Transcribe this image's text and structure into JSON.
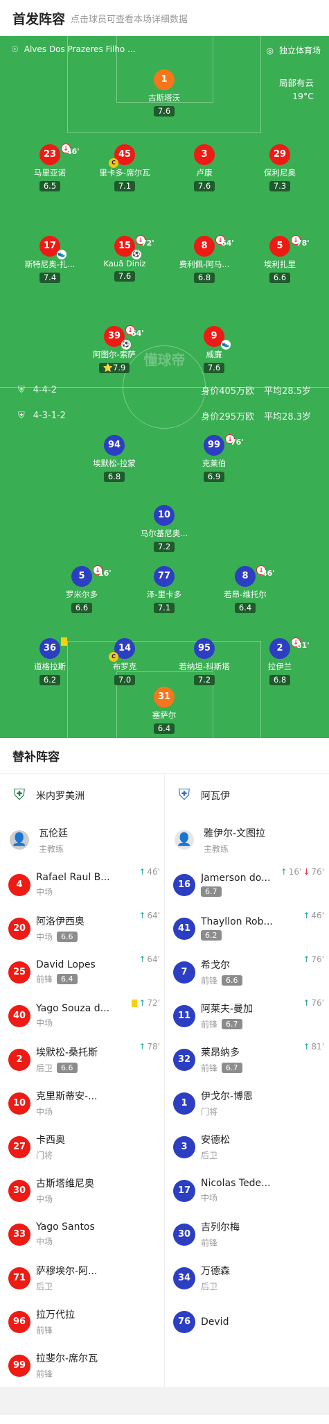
{
  "header": {
    "title": "首发阵容",
    "subtitle": "点击球员可查看本场详细数据"
  },
  "pitch_info": {
    "referee": "Alves Dos Prazeres Filho ...",
    "venue": "独立体育场",
    "weather": "局部有云",
    "temp": "19°C",
    "watermark": "懂球帝"
  },
  "home": {
    "formation": "4-4-2",
    "value": "身价405万欧",
    "age": "平均28.5岁",
    "color": "#ee1a14"
  },
  "away": {
    "formation": "4-3-1-2",
    "value": "身价295万欧",
    "age": "平均28.3岁",
    "color": "#2c3ec2"
  },
  "home_players": [
    {
      "num": "1",
      "name": "古斯塔沃",
      "rating": "7.6"
    },
    {
      "num": "23",
      "name": "马里亚诺",
      "rating": "6.5",
      "sub": "46'"
    },
    {
      "num": "45",
      "name": "里卡多-席尔瓦",
      "rating": "7.1"
    },
    {
      "num": "3",
      "name": "卢康",
      "rating": "7.6"
    },
    {
      "num": "29",
      "name": "保利尼奥",
      "rating": "7.3"
    },
    {
      "num": "17",
      "name": "斯特尼奥-扎...",
      "rating": "7.4"
    },
    {
      "num": "15",
      "name": "Kauã Diniz",
      "rating": "7.6",
      "sub": "72'"
    },
    {
      "num": "8",
      "name": "费利佩-阿马...",
      "rating": "6.8",
      "sub": "64'"
    },
    {
      "num": "5",
      "name": "埃利扎里",
      "rating": "6.6",
      "sub": "78'"
    },
    {
      "num": "39",
      "name": "阿图尔-索萨",
      "rating": "7.9",
      "sub": "64'"
    },
    {
      "num": "9",
      "name": "威廉",
      "rating": "7.6"
    }
  ],
  "away_players": [
    {
      "num": "94",
      "name": "埃默松-拉蒙",
      "rating": "6.8"
    },
    {
      "num": "99",
      "name": "克莱伯",
      "rating": "6.9",
      "sub": "76'"
    },
    {
      "num": "10",
      "name": "马尔基尼奥...",
      "rating": "7.2"
    },
    {
      "num": "5",
      "name": "罗米尔多",
      "rating": "6.6",
      "sub": "16'"
    },
    {
      "num": "77",
      "name": "泽-里卡多",
      "rating": "7.1"
    },
    {
      "num": "8",
      "name": "若昂-维托尔",
      "rating": "6.4",
      "sub": "46'"
    },
    {
      "num": "36",
      "name": "道格拉斯",
      "rating": "6.2"
    },
    {
      "num": "14",
      "name": "布罗克",
      "rating": "7.0"
    },
    {
      "num": "95",
      "name": "若纳坦-科斯塔",
      "rating": "7.2"
    },
    {
      "num": "2",
      "name": "拉伊兰",
      "rating": "6.8",
      "sub": "81'"
    },
    {
      "num": "31",
      "name": "塞萨尔",
      "rating": "6.4"
    }
  ],
  "subs": {
    "title": "替补阵容",
    "home": {
      "team": "米内罗美洲",
      "coach": "瓦伦廷",
      "coach_role": "主教练",
      "list": [
        {
          "num": "4",
          "name": "Rafael Raul B...",
          "pos": "中场",
          "in": "46'"
        },
        {
          "num": "20",
          "name": "阿洛伊西奥",
          "pos": "中场",
          "rating": "6.6",
          "in": "64'"
        },
        {
          "num": "25",
          "name": "David Lopes",
          "pos": "前锋",
          "rating": "6.4",
          "in": "64'"
        },
        {
          "num": "40",
          "name": "Yago Souza d...",
          "pos": "中场",
          "in": "72'"
        },
        {
          "num": "2",
          "name": "埃默松-桑托斯",
          "pos": "后卫",
          "rating": "6.6",
          "in": "78'"
        },
        {
          "num": "10",
          "name": "克里斯蒂安-...",
          "pos": "中场"
        },
        {
          "num": "27",
          "name": "卡西奥",
          "pos": "门将"
        },
        {
          "num": "30",
          "name": "古斯塔维尼奥",
          "pos": "中场"
        },
        {
          "num": "33",
          "name": "Yago Santos",
          "pos": "中场"
        },
        {
          "num": "71",
          "name": "萨穆埃尔-阿...",
          "pos": "后卫"
        },
        {
          "num": "96",
          "name": "拉万代拉",
          "pos": "前锋"
        },
        {
          "num": "99",
          "name": "拉斐尔-席尔瓦",
          "pos": "前锋"
        }
      ]
    },
    "away": {
      "team": "阿瓦伊",
      "coach": "雅伊尔-文图拉",
      "coach_role": "主教练",
      "list": [
        {
          "num": "16",
          "name": "Jamerson do...",
          "rating": "6.7",
          "in": "16'",
          "out": "76'"
        },
        {
          "num": "41",
          "name": "Thayllon Rob...",
          "rating": "6.2",
          "in": "46'"
        },
        {
          "num": "7",
          "name": "希戈尔",
          "pos": "前锋",
          "rating": "6.6",
          "in": "76'"
        },
        {
          "num": "11",
          "name": "阿莱夫-曼加",
          "pos": "前锋",
          "rating": "6.7",
          "in": "76'"
        },
        {
          "num": "32",
          "name": "莱昂纳多",
          "pos": "前锋",
          "rating": "6.7",
          "in": "81'"
        },
        {
          "num": "1",
          "name": "伊戈尔-博恩",
          "pos": "门将"
        },
        {
          "num": "3",
          "name": "安德松",
          "pos": "后卫"
        },
        {
          "num": "17",
          "name": "Nicolas Tede...",
          "pos": "中场"
        },
        {
          "num": "30",
          "name": "吉列尔梅",
          "pos": "前锋"
        },
        {
          "num": "34",
          "name": "万德森",
          "pos": "后卫"
        },
        {
          "num": "76",
          "name": "Devid"
        }
      ]
    }
  }
}
